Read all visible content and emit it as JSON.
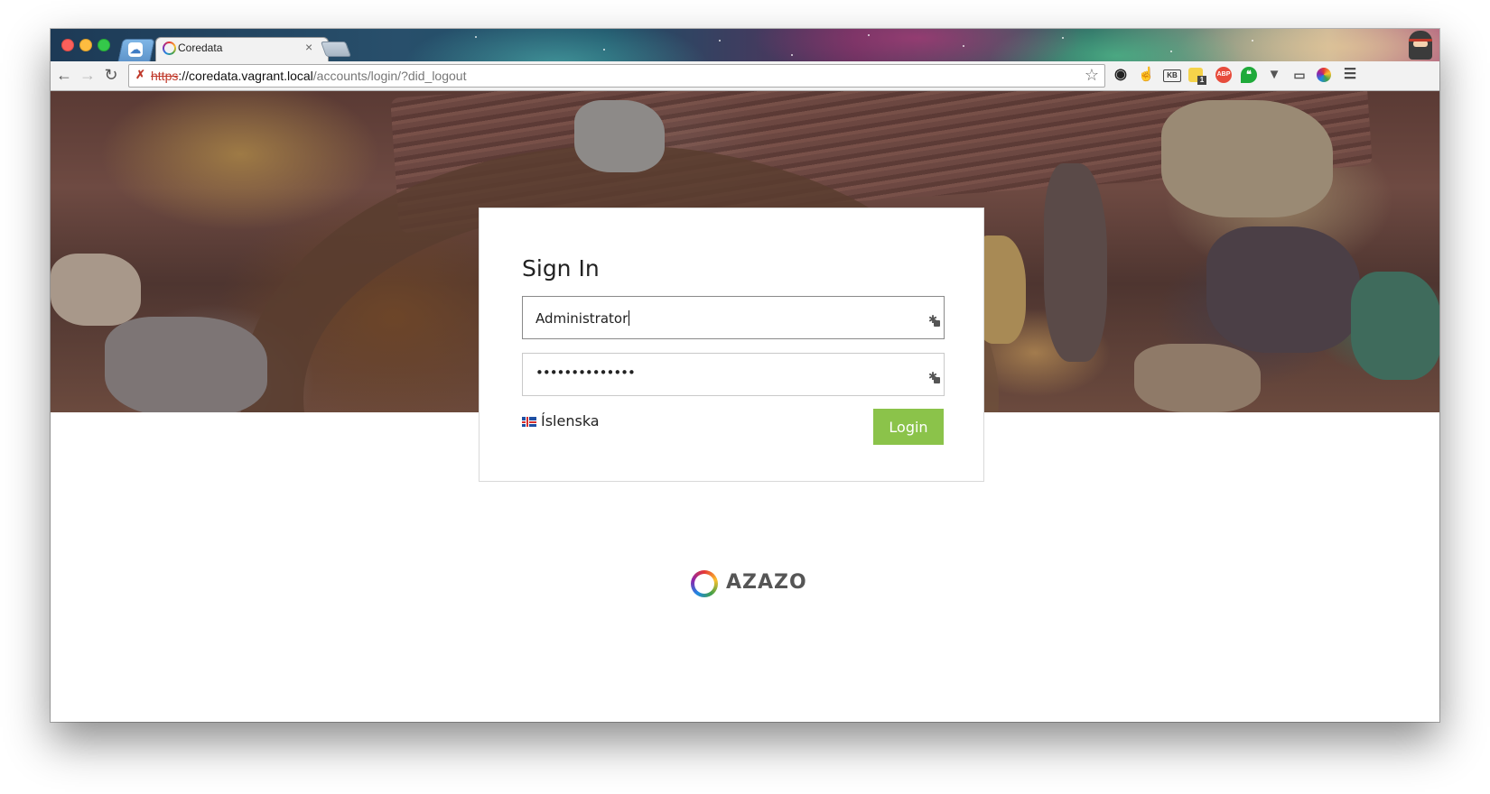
{
  "browser": {
    "tab_title": "Coredata",
    "url": {
      "scheme": "https",
      "host": "://coredata.vagrant.local",
      "path": "/accounts/login/?did_logout"
    },
    "extensions": [
      "github-icon",
      "like-icon",
      "kb-icon",
      "notification-badge-icon",
      "adblock-icon",
      "hangouts-icon",
      "pocket-icon",
      "cast-icon",
      "color-picker-icon",
      "menu-icon"
    ],
    "extension_labels": {
      "kb": "KB",
      "abp": "ABP",
      "badge": "1"
    }
  },
  "login": {
    "title": "Sign In",
    "username_value": "Administrator",
    "password_value": "••••••••••••••",
    "language": "Íslenska",
    "submit_label": "Login"
  },
  "brand": {
    "name": "AZAZO"
  },
  "colors": {
    "accent": "#8bc34a",
    "insecure": "#c0392b"
  }
}
